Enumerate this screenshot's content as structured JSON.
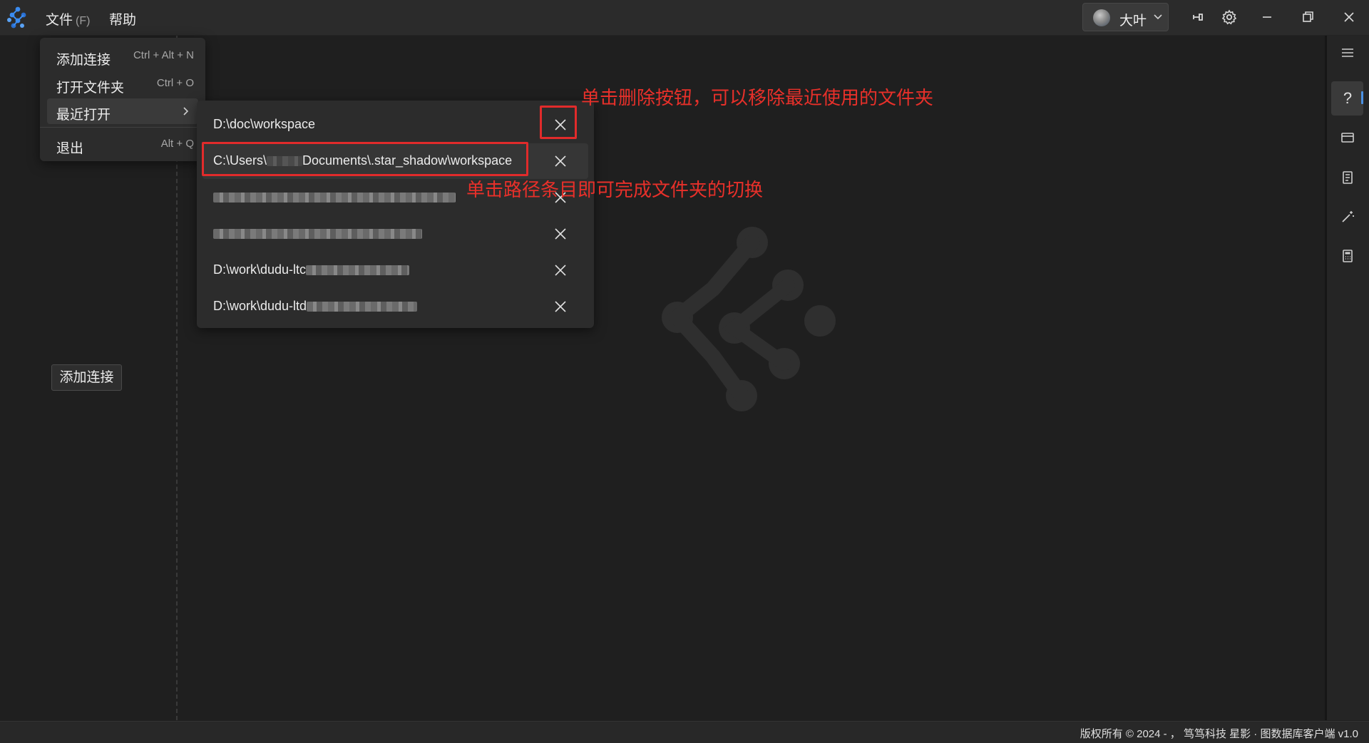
{
  "titlebar": {
    "menus": [
      {
        "label": "文件",
        "accel": "(F)"
      },
      {
        "label": "帮助"
      }
    ],
    "user_name": "大叶",
    "icons": [
      "app-logo-icon",
      "pin-icon",
      "gear-icon",
      "minimize-icon",
      "restore-icon",
      "close-icon"
    ]
  },
  "file_menu": {
    "items": [
      {
        "label": "添加连接",
        "shortcut": "Ctrl + Alt + N"
      },
      {
        "label": "打开文件夹",
        "shortcut": "Ctrl + O"
      },
      {
        "label": "最近打开",
        "shortcut": ""
      },
      {
        "label": "退出",
        "shortcut": "Alt + Q"
      }
    ]
  },
  "recent_folders": [
    {
      "path": "D:\\doc\\workspace"
    },
    {
      "path_prefix": "C:\\Users\\",
      "path_suffix": "Documents\\.star_shadow\\workspace"
    },
    {
      "path": ""
    },
    {
      "path": ""
    },
    {
      "path_prefix": "D:\\work\\dudu-ltc"
    },
    {
      "path_prefix": "D:\\work\\dudu-ltd"
    }
  ],
  "sidebar": {
    "add_connection_button": "添加连接"
  },
  "right_panel": {
    "icons": [
      "menu-icon",
      "help-icon",
      "card-icon",
      "document-icon",
      "magic-wand-icon",
      "calculator-icon"
    ],
    "help_label": "?",
    "accent_color": "#4a90e2"
  },
  "annotations": {
    "delete_hint": "单击删除按钮，可以移除最近使用的文件夹",
    "switch_hint": "单击路径条目即可完成文件夹的切换",
    "color": "#e12b2b"
  },
  "status_bar": {
    "copyright": "版权所有 © 2024 - ， 笃笃科技 星影 · 图数据库客户端 v1.0"
  }
}
